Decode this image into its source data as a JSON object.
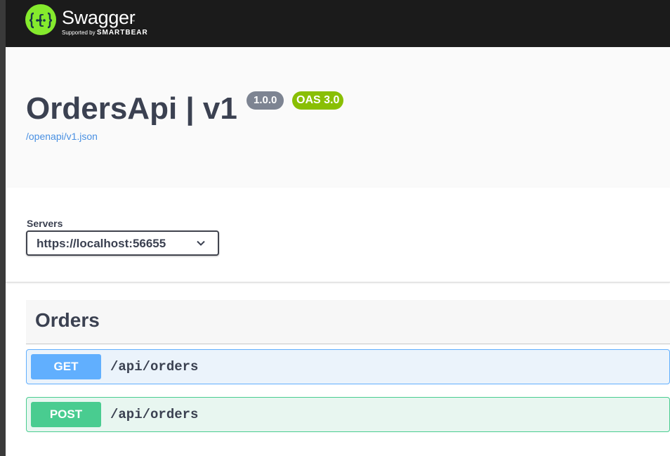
{
  "header": {
    "logo_title": "Swagger",
    "logo_tm": "™",
    "logo_supported": "Supported by",
    "logo_brand": "SMARTBEAR",
    "logo_icon": "swagger-braces-icon"
  },
  "info": {
    "title": "OrdersApi | v1",
    "version": "1.0.0",
    "oas": "OAS 3.0",
    "spec_link": "/openapi/v1.json"
  },
  "servers": {
    "label": "Servers",
    "selected": "https://localhost:56655"
  },
  "operations": {
    "tag": "Orders",
    "items": [
      {
        "method": "GET",
        "path": "/api/orders"
      },
      {
        "method": "POST",
        "path": "/api/orders"
      }
    ]
  },
  "colors": {
    "topbar": "#1b1b1b",
    "logo_green": "#85ea2d",
    "version_badge": "#7d8492",
    "oas_badge": "#89bf04",
    "get": "#61affe",
    "post": "#49cc90",
    "link": "#4990e2"
  }
}
